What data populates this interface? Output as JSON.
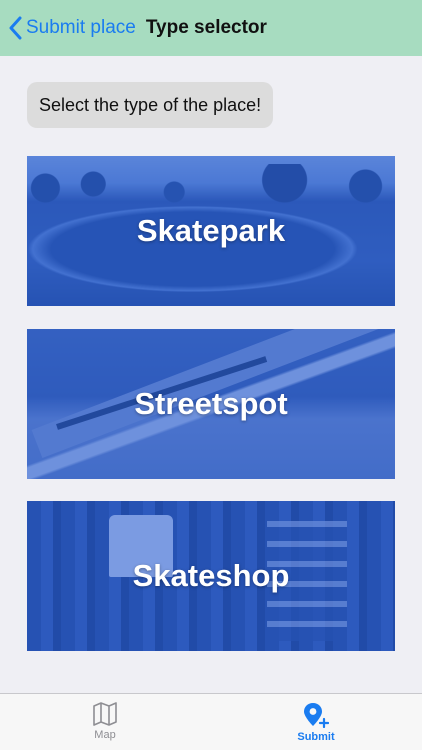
{
  "navbar": {
    "back_label": "Submit place",
    "title": "Type selector",
    "back_icon": "chevron-left-icon"
  },
  "hint": "Select the type of the place!",
  "types": [
    {
      "label": "Skatepark"
    },
    {
      "label": "Streetspot"
    },
    {
      "label": "Skateshop"
    }
  ],
  "tabs": [
    {
      "label": "Map",
      "icon": "map-icon",
      "selected": false
    },
    {
      "label": "Submit",
      "icon": "pin-plus-icon",
      "selected": true
    }
  ],
  "colors": {
    "navbar": "#a7dcc0",
    "accent": "#1a7cf0",
    "overlay": "#235ad2",
    "background": "#efeff4"
  }
}
